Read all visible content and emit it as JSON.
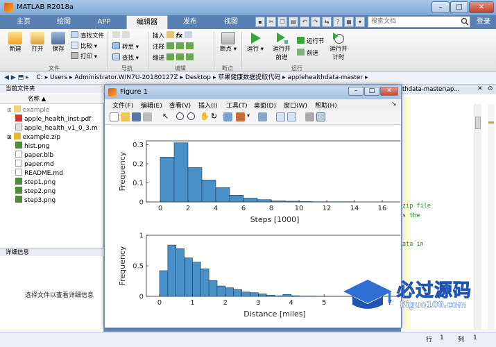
{
  "window": {
    "title": "MATLAB R2018a",
    "buttons": [
      "–",
      "□",
      "✕"
    ]
  },
  "tabs": [
    "主页",
    "绘图",
    "APP",
    "编辑器",
    "发布",
    "视图"
  ],
  "active_tab": "编辑器",
  "search": {
    "placeholder": "搜索文档"
  },
  "login": "登录",
  "toolstrip": {
    "new": "新建",
    "open": "打开",
    "save": "保存",
    "find_files": "查找文件",
    "compare": "比较",
    "print": "打印",
    "file_group": "文件",
    "goto": "转至",
    "find": "查找",
    "nav_group": "导航",
    "insert": "插入",
    "comment": "注释",
    "indent": "缩进",
    "edit_group": "编辑",
    "breakpoints": "断点",
    "bp_group": "断点",
    "run": "运行",
    "run_advance_1": "运行并",
    "run_advance_2": "前进",
    "run_section": "运行节",
    "advance": "前进",
    "run_time_1": "运行并",
    "run_time_2": "计时",
    "run_group": "运行"
  },
  "address": {
    "segments": [
      "C:",
      "Users",
      "Administrator.WIN7U-20180127Z",
      "Desktop",
      "苹果健康数据提取代码",
      "applehealthdata-master"
    ]
  },
  "left_panel": {
    "header": "当前文件夹",
    "column": "名称 ▲",
    "files": [
      {
        "name": "example",
        "type": "folder"
      },
      {
        "name": "apple_health_inst.pdf",
        "type": "pdf"
      },
      {
        "name": "apple_health_v1_0_3.m",
        "type": "m"
      },
      {
        "name": "example.zip",
        "type": "zip"
      },
      {
        "name": "hist.png",
        "type": "png"
      },
      {
        "name": "paper.bib",
        "type": "txt"
      },
      {
        "name": "paper.md",
        "type": "txt"
      },
      {
        "name": "README.md",
        "type": "txt"
      },
      {
        "name": "step1.png",
        "type": "png"
      },
      {
        "name": "step2.png",
        "type": "png"
      },
      {
        "name": "step3.png",
        "type": "png"
      }
    ],
    "details_header": "详细信息",
    "details_text": "选择文件以查看详细信息"
  },
  "editor": {
    "tab_text": "thdata-master\\ap...",
    "code_lines": [
      "zip file",
      "s the",
      "ata in"
    ]
  },
  "status": {
    "row_label": "行",
    "row": "1",
    "col_label": "列",
    "col": "1"
  },
  "figure": {
    "title": "Figure 1",
    "menu": [
      "文件(F)",
      "编辑(E)",
      "查看(V)",
      "插入(I)",
      "工具(T)",
      "桌面(D)",
      "窗口(W)",
      "帮助(H)"
    ]
  },
  "watermark": {
    "text": "必过源码",
    "url": "Biguo100.com"
  },
  "colors": {
    "bar_fill": "#4a90c8",
    "bar_stroke": "#1a3a5a",
    "titlebar": "#8fb3dc",
    "code_green": "#228b22"
  },
  "chart_data": [
    {
      "type": "bar",
      "xlabel": "Steps [1000]",
      "ylabel": "Frequency",
      "xlim": [
        -1,
        17.5
      ],
      "ylim": [
        0,
        0.32
      ],
      "xticks": [
        0,
        2,
        4,
        6,
        8,
        10,
        12,
        14,
        16
      ],
      "yticks": [
        0,
        0.1,
        0.2,
        0.3
      ],
      "bin_width": 1,
      "bin_centers": [
        0.5,
        1.5,
        2.5,
        3.5,
        4.5,
        5.5,
        6.5,
        7.5,
        8.5,
        9.5,
        10.5,
        11.5,
        12.5,
        13.5
      ],
      "values": [
        0.235,
        0.31,
        0.18,
        0.115,
        0.075,
        0.035,
        0.02,
        0.012,
        0.006,
        0.004,
        0.002,
        0.001,
        0.001,
        0.001
      ]
    },
    {
      "type": "bar",
      "xlabel": "Distance [miles]",
      "ylabel": "Frequency",
      "xlim": [
        -0.4,
        7.4
      ],
      "ylim": [
        0,
        1.0
      ],
      "xticks": [
        0,
        1,
        2,
        3,
        4,
        5,
        6,
        7
      ],
      "yticks": [
        0,
        0.5,
        1
      ],
      "bin_width": 0.25,
      "bin_centers": [
        0.125,
        0.375,
        0.625,
        0.875,
        1.125,
        1.375,
        1.625,
        1.875,
        2.125,
        2.375,
        2.625,
        2.875,
        3.125,
        3.375,
        3.625,
        3.875,
        4.125,
        4.375,
        4.625,
        4.875,
        5.125,
        5.375,
        5.625,
        5.875
      ],
      "values": [
        0.42,
        0.84,
        0.78,
        0.63,
        0.56,
        0.45,
        0.26,
        0.17,
        0.14,
        0.11,
        0.07,
        0.06,
        0.04,
        0.02,
        0.01,
        0.03,
        0.01,
        0.005,
        0.005,
        0.003,
        0.002,
        0.002,
        0.001,
        0.001
      ]
    }
  ]
}
